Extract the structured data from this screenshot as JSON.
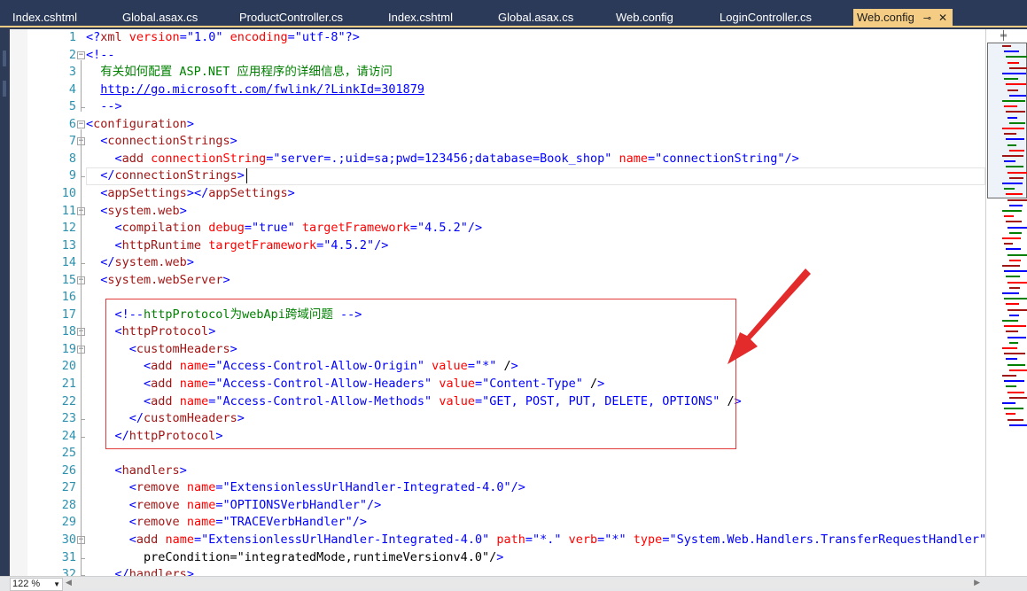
{
  "tabs": [
    {
      "label": "Index.cshtml"
    },
    {
      "label": "Global.asax.cs"
    },
    {
      "label": "ProductController.cs"
    },
    {
      "label": "Index.cshtml"
    },
    {
      "label": "Global.asax.cs"
    },
    {
      "label": "Web.config"
    },
    {
      "label": "LoginController.cs"
    },
    {
      "label": "Web.config",
      "active": true
    }
  ],
  "tab_pin_glyph": "⊸",
  "tab_close_glyph": "✕",
  "code_lines": [
    {
      "n": "1",
      "text": "<?xml version=\"1.0\" encoding=\"utf-8\"?>"
    },
    {
      "n": "2",
      "text": "<!--"
    },
    {
      "n": "3",
      "text": "  有关如何配置 ASP.NET 应用程序的详细信息，请访问"
    },
    {
      "n": "4",
      "text": "  http://go.microsoft.com/fwlink/?LinkId=301879"
    },
    {
      "n": "5",
      "text": "  -->"
    },
    {
      "n": "6",
      "text": "<configuration>"
    },
    {
      "n": "7",
      "text": "  <connectionStrings>"
    },
    {
      "n": "8",
      "text": "    <add connectionString=\"server=.;uid=sa;pwd=123456;database=Book_shop\" name=\"connectionString\"/>"
    },
    {
      "n": "9",
      "text": "  </connectionStrings>"
    },
    {
      "n": "10",
      "text": "  <appSettings></appSettings>"
    },
    {
      "n": "11",
      "text": "  <system.web>"
    },
    {
      "n": "12",
      "text": "    <compilation debug=\"true\" targetFramework=\"4.5.2\"/>"
    },
    {
      "n": "13",
      "text": "    <httpRuntime targetFramework=\"4.5.2\"/>"
    },
    {
      "n": "14",
      "text": "  </system.web>"
    },
    {
      "n": "15",
      "text": "  <system.webServer>"
    },
    {
      "n": "16",
      "text": ""
    },
    {
      "n": "17",
      "text": "    <!--httpProtocol为webApi跨域问题 -->"
    },
    {
      "n": "18",
      "text": "    <httpProtocol>"
    },
    {
      "n": "19",
      "text": "      <customHeaders>"
    },
    {
      "n": "20",
      "text": "        <add name=\"Access-Control-Allow-Origin\" value=\"*\" />"
    },
    {
      "n": "21",
      "text": "        <add name=\"Access-Control-Allow-Headers\" value=\"Content-Type\" />"
    },
    {
      "n": "22",
      "text": "        <add name=\"Access-Control-Allow-Methods\" value=\"GET, POST, PUT, DELETE, OPTIONS\" />"
    },
    {
      "n": "23",
      "text": "      </customHeaders>"
    },
    {
      "n": "24",
      "text": "    </httpProtocol>"
    },
    {
      "n": "25",
      "text": ""
    },
    {
      "n": "26",
      "text": "    <handlers>"
    },
    {
      "n": "27",
      "text": "      <remove name=\"ExtensionlessUrlHandler-Integrated-4.0\"/>"
    },
    {
      "n": "28",
      "text": "      <remove name=\"OPTIONSVerbHandler\"/>"
    },
    {
      "n": "29",
      "text": "      <remove name=\"TRACEVerbHandler\"/>"
    },
    {
      "n": "30",
      "text": "      <add name=\"ExtensionlessUrlHandler-Integrated-4.0\" path=\"*.\" verb=\"*\" type=\"System.Web.Handlers.TransferRequestHandler\""
    },
    {
      "n": "31",
      "text": "        preCondition=\"integratedMode,runtimeVersionv4.0\"/>"
    },
    {
      "n": "32",
      "text": "    </handlers>"
    }
  ],
  "status": {
    "zoom": "122 %"
  },
  "colors": {
    "tab_bar": "#2b3a58",
    "active_tab": "#f5cc84",
    "line_numbers": "#2b91af",
    "xml_tag": "#a31515",
    "xml_attr": "#ff0000",
    "xml_string": "#0000ff",
    "comment": "#008000",
    "highlight_box": "#e33a3a",
    "arrow": "#e32b2b"
  }
}
